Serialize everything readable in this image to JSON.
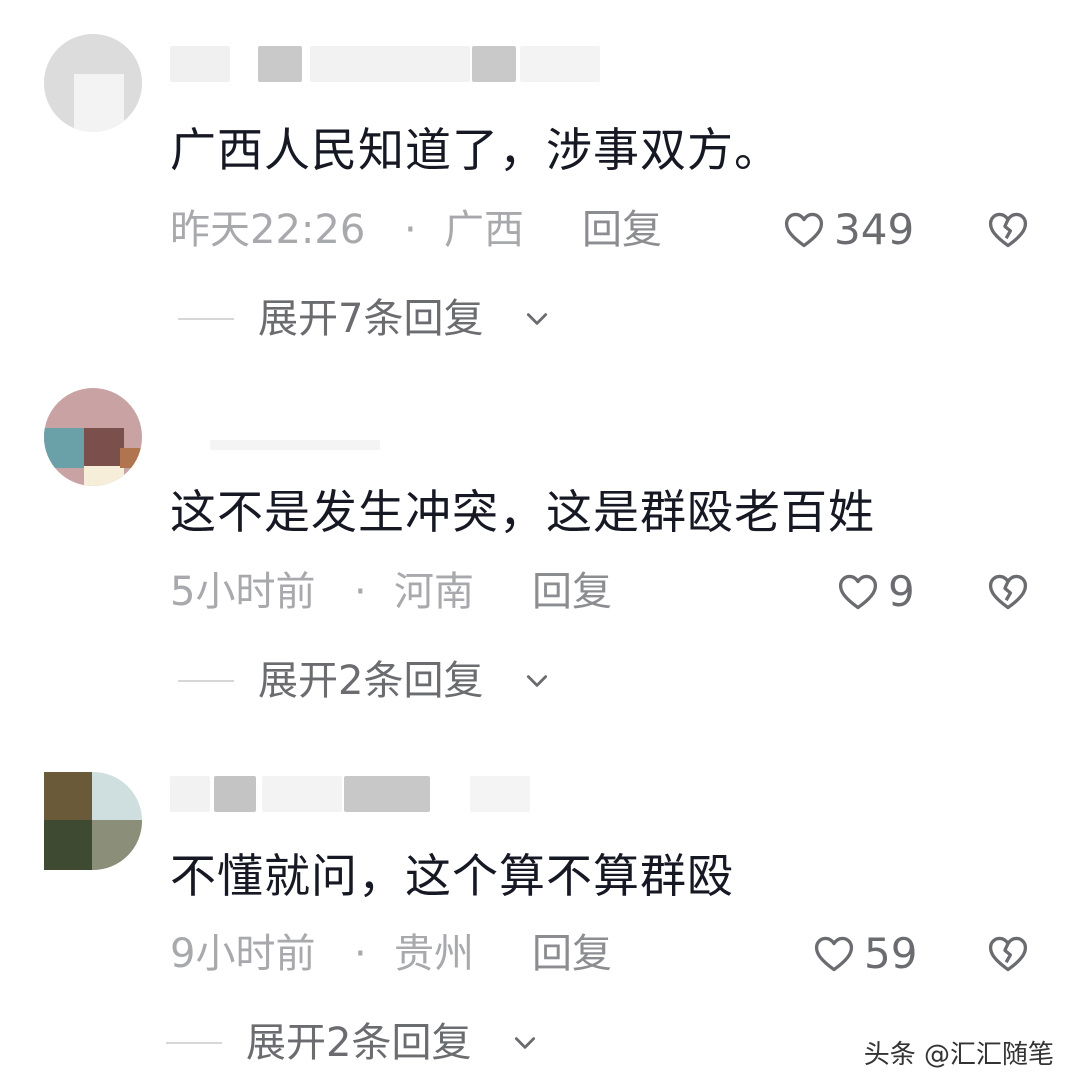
{
  "comments": [
    {
      "text": "广西人民知道了，涉事双方。",
      "time": "昨天22:26",
      "sep": "·",
      "location": "广西",
      "reply_label": "回复",
      "likes": "349",
      "expand_label": "展开7条回复"
    },
    {
      "text": "这不是发生冲突，这是群殴老百姓",
      "time": "5小时前",
      "sep": "·",
      "location": "河南",
      "reply_label": "回复",
      "likes": "9",
      "expand_label": "展开2条回复"
    },
    {
      "text": "不懂就问，这个算不算群殴",
      "time": "9小时前",
      "sep": "·",
      "location": "贵州",
      "reply_label": "回复",
      "likes": "59",
      "expand_label": "展开2条回复"
    }
  ],
  "watermark": "头条 @汇汇随笔",
  "icons": {
    "like": "heart-outline-icon",
    "dislike": "broken-heart-icon",
    "expand": "chevron-down-icon"
  },
  "colors": {
    "text": "#161823",
    "meta": "#a8a9ad",
    "icon": "#6b6c70"
  }
}
